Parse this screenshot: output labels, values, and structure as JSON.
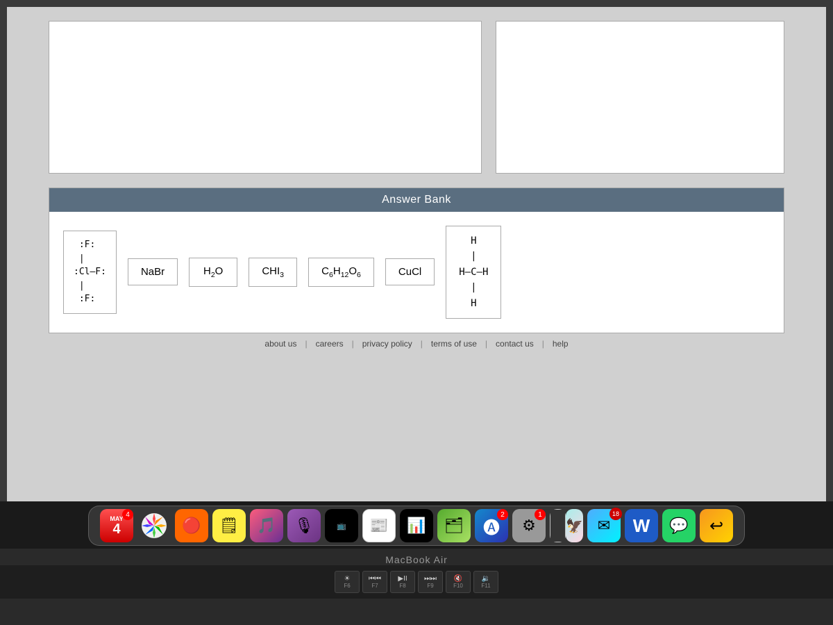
{
  "screen": {
    "answer_bank_title": "Answer Bank",
    "top_boxes": [
      {
        "id": "box-left",
        "content": ""
      },
      {
        "id": "box-right",
        "content": ""
      }
    ],
    "answer_items": [
      {
        "id": "lewis-clf3",
        "type": "lewis",
        "display": "ClF3-lewis"
      },
      {
        "id": "nabr",
        "type": "formula",
        "display": "NaBr"
      },
      {
        "id": "h2o",
        "type": "formula",
        "display": "H₂O"
      },
      {
        "id": "chi3",
        "type": "formula",
        "display": "CHI₃"
      },
      {
        "id": "c6h12o6",
        "type": "formula",
        "display": "C₆H₁₂O₆"
      },
      {
        "id": "cucl",
        "type": "formula",
        "display": "CuCl"
      },
      {
        "id": "methane",
        "type": "structural",
        "display": "CH4-structural"
      }
    ],
    "footer": {
      "links": [
        "about us",
        "careers",
        "privacy policy",
        "terms of use",
        "contact us",
        "help"
      ]
    }
  },
  "dock": {
    "items": [
      {
        "name": "calendar",
        "emoji": "📅",
        "label": "Calendar",
        "badge": "4"
      },
      {
        "name": "photos",
        "emoji": "🖼",
        "label": "Photos"
      },
      {
        "name": "reminders",
        "emoji": "📝",
        "label": "Reminders"
      },
      {
        "name": "notes",
        "emoji": "🗒",
        "label": "Notes"
      },
      {
        "name": "music",
        "emoji": "🎵",
        "label": "Music"
      },
      {
        "name": "podcasts",
        "emoji": "🎙",
        "label": "Podcasts"
      },
      {
        "name": "apple-tv",
        "emoji": "📺",
        "label": "TV"
      },
      {
        "name": "news",
        "emoji": "📰",
        "label": "News"
      },
      {
        "name": "stocks",
        "emoji": "📊",
        "label": "Stocks"
      },
      {
        "name": "finder",
        "emoji": "🗂",
        "label": "Finder"
      },
      {
        "name": "app-store",
        "emoji": "🅐",
        "label": "App Store",
        "badge": "2"
      },
      {
        "name": "system-prefs",
        "emoji": "⚙",
        "label": "Sys Prefs",
        "badge": "1"
      },
      {
        "name": "mail",
        "emoji": "✉",
        "label": "Mail"
      },
      {
        "name": "word",
        "emoji": "W",
        "label": "Word"
      },
      {
        "name": "whatsapp",
        "emoji": "💬",
        "label": "WhatsApp"
      },
      {
        "name": "back",
        "emoji": "↩",
        "label": "Back"
      }
    ]
  },
  "macbook": {
    "label": "MacBook Air"
  },
  "keyboard": {
    "fn_keys": [
      "F6",
      "F7",
      "F8",
      "F9",
      "F10",
      "F11"
    ],
    "media_keys": [
      "⏮",
      "⏯",
      "⏭"
    ]
  }
}
